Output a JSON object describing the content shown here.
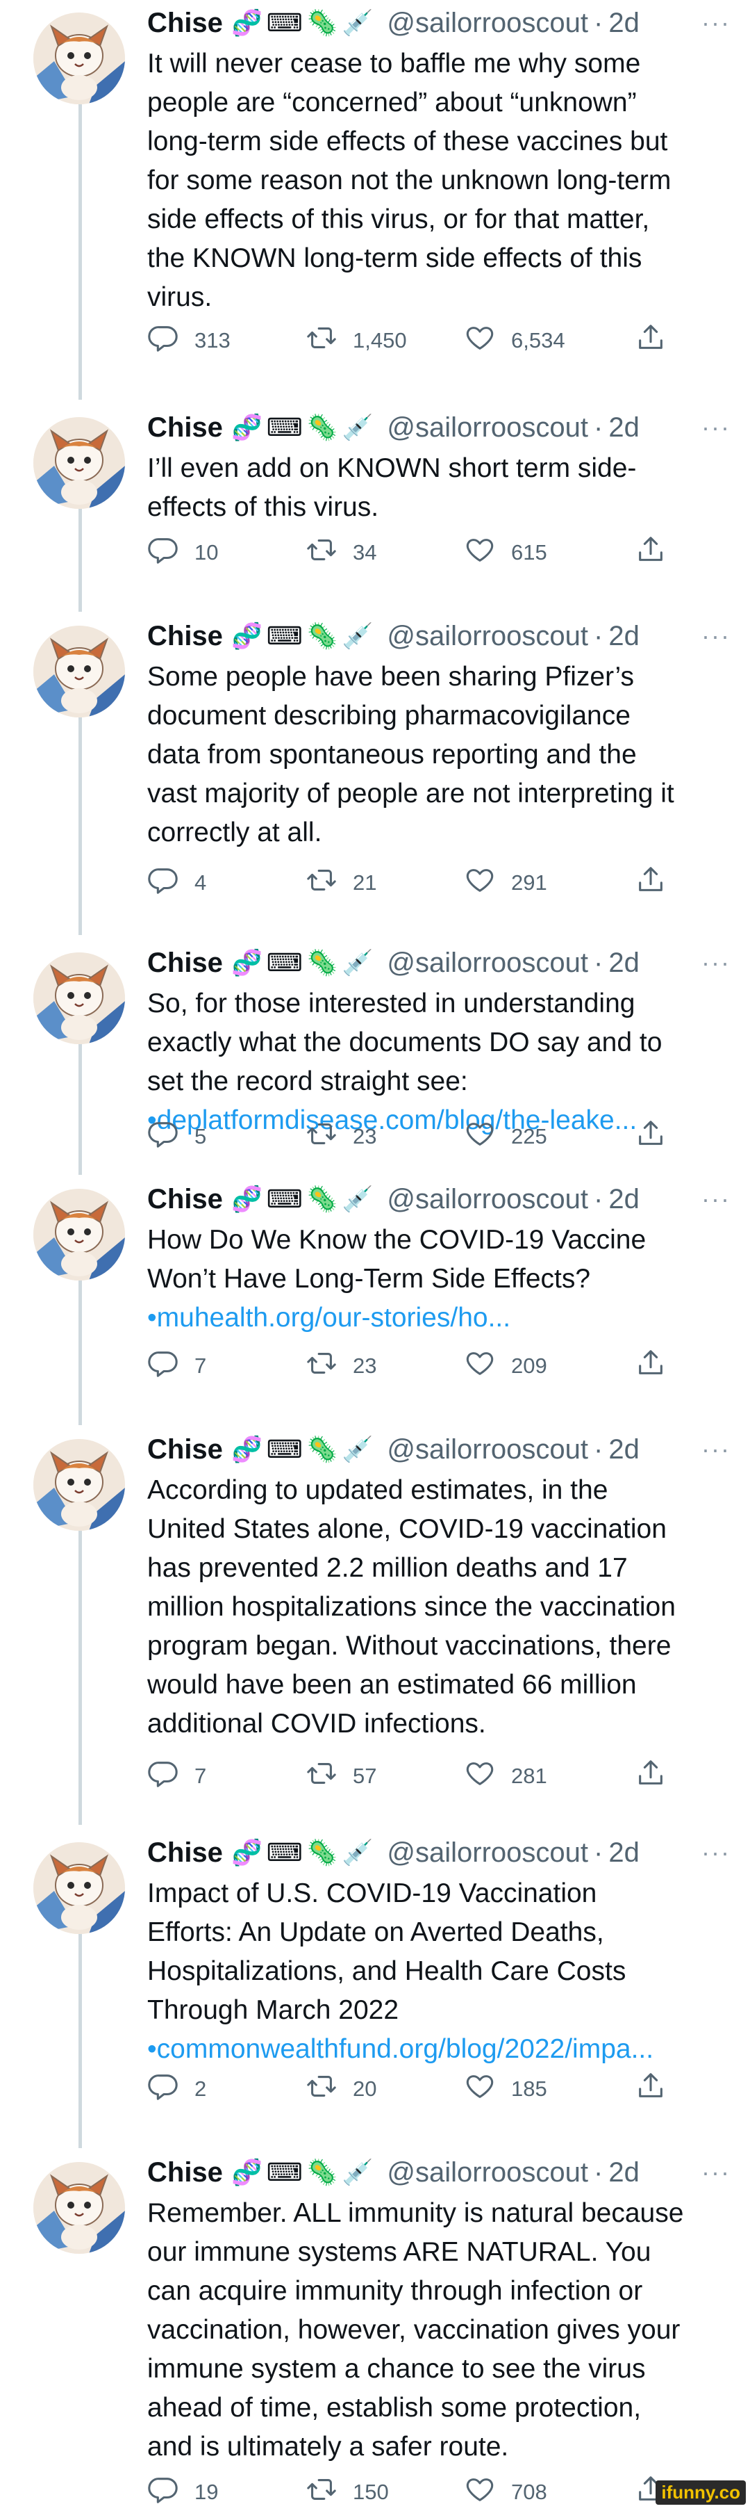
{
  "author": {
    "name": "Chise",
    "emoji": [
      "🧬",
      "⌨",
      "🦠",
      "💉"
    ],
    "handle": "@sailorrooscout",
    "time": "2d",
    "more": "···"
  },
  "tweets": [
    {
      "lines": [
        "It will never cease to baffle me why some",
        "people are “concerned” about “unknown”",
        "long-term side effects of these vaccines but",
        "for some reason not the unknown long-term",
        "side effects of this virus, or for that matter,",
        "the KNOWN long-term side effects of this",
        "virus."
      ],
      "link": "",
      "replies": "313",
      "retweets": "1,450",
      "likes": "6,534"
    },
    {
      "lines": [
        "I’ll even add on KNOWN short term side-",
        "effects of this virus."
      ],
      "link": "",
      "replies": "10",
      "retweets": "34",
      "likes": "615"
    },
    {
      "lines": [
        "Some people have been sharing Pfizer’s",
        "document describing pharmacovigilance",
        "data from spontaneous reporting and the",
        "vast majority of people are not interpreting it",
        "correctly at all."
      ],
      "link": "",
      "replies": "4",
      "retweets": "21",
      "likes": "291"
    },
    {
      "lines": [
        "So, for those interested in understanding",
        "exactly what the documents DO say and to",
        "set the record straight see:"
      ],
      "link": "deplatformdisease.com/blog/the-leake...",
      "replies": "5",
      "retweets": "23",
      "likes": "225"
    },
    {
      "lines": [
        "How Do We Know the COVID-19 Vaccine",
        "Won’t Have Long-Term Side Effects?"
      ],
      "link": "muhealth.org/our-stories/ho...",
      "replies": "7",
      "retweets": "23",
      "likes": "209"
    },
    {
      "lines": [
        "According to updated estimates, in the",
        "United States alone, COVID-19 vaccination",
        "has prevented 2.2 million deaths and 17",
        "million hospitalizations since the vaccination",
        "program began. Without vaccinations, there",
        "would have been an estimated 66 million",
        "additional COVID infections."
      ],
      "link": "",
      "replies": "7",
      "retweets": "57",
      "likes": "281"
    },
    {
      "lines": [
        "Impact of U.S. COVID-19 Vaccination",
        "Efforts: An Update on Averted Deaths,",
        "Hospitalizations, and Health Care Costs",
        "Through March 2022"
      ],
      "link": "commonwealthfund.org/blog/2022/impa...",
      "replies": "2",
      "retweets": "20",
      "likes": "185"
    },
    {
      "lines": [
        "Remember. ALL immunity is natural because",
        "our immune systems ARE NATURAL. You",
        "can acquire immunity through infection or",
        "vaccination, however, vaccination gives your",
        "immune system a chance to see the virus",
        "ahead of time, establish some protection,",
        "and is ultimately a safer route."
      ],
      "link": "",
      "replies": "19",
      "retweets": "150",
      "likes": "708"
    }
  ],
  "link_bullet": "•",
  "watermark": "ifunny.co",
  "colors": {
    "link": "#1d9bf0",
    "muted": "#536471",
    "thread_line": "#cfd9de"
  }
}
